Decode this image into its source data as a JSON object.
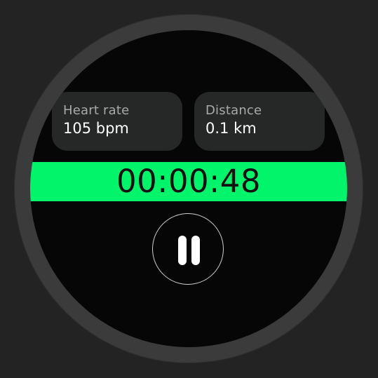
{
  "metrics": {
    "heart_rate": {
      "label": "Heart rate",
      "value": "105 bpm"
    },
    "distance": {
      "label": "Distance",
      "value": "0.1 km"
    }
  },
  "timer": {
    "elapsed": "00:00:48"
  },
  "controls": {
    "pause_icon": "pause-icon"
  },
  "colors": {
    "accent": "#02f46a",
    "screen": "#060606",
    "card": "#252827",
    "bezel": "#3b3b3b",
    "background": "#232323"
  }
}
